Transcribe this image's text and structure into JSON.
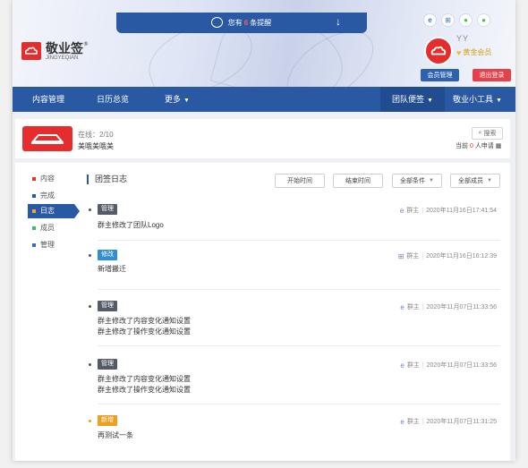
{
  "header": {
    "notice": {
      "prefix": "您有",
      "count": "6",
      "suffix": "条提醒"
    },
    "brand": {
      "name": "敬业签",
      "registered": "®",
      "sub": "JINGYEQIAN"
    },
    "apps": [
      {
        "icon": "ie-icon",
        "glyph": "e",
        "color": "#2f7ad8"
      },
      {
        "icon": "windows-icon",
        "glyph": "⊞",
        "color": "#2f7ad8"
      },
      {
        "icon": "apple-icon",
        "glyph": "●",
        "color": "#57b94a"
      },
      {
        "icon": "android-icon",
        "glyph": "●",
        "color": "#57b94a"
      }
    ],
    "user": {
      "name": "YY",
      "level": "黄金会员"
    },
    "member_button": "会员管理",
    "logout_button": "退出登录"
  },
  "nav": {
    "items": [
      "内容管理",
      "日历总览",
      "更多"
    ],
    "team_note": "团队便签",
    "tools": "敬业小工具"
  },
  "team": {
    "online": "在线：2/10",
    "name": "美哦美哦美",
    "search": "搜索",
    "apply_prefix": "当前",
    "apply_count": "0",
    "apply_suffix": "人申请"
  },
  "sidebar": {
    "items": [
      {
        "label": "内容",
        "color": "#e5322d"
      },
      {
        "label": "完成",
        "color": "#2a59a4"
      },
      {
        "label": "日志",
        "color": "#f3a531"
      },
      {
        "label": "成员",
        "color": "#3bbf6b"
      },
      {
        "label": "管理",
        "color": "#3a6bc4"
      }
    ]
  },
  "log": {
    "title": "团签日志",
    "filters": {
      "start": "开始时间",
      "end": "结束时间",
      "condition": "全部条件",
      "members": "全部成员"
    },
    "entries": [
      {
        "tag": "管理",
        "tag_color": "#555b66",
        "lines": [
          "群主修改了团队Logo"
        ],
        "author": "群主",
        "time": "2020年11月16日17:41:54"
      },
      {
        "tag": "修改",
        "tag_color": "#2e8fd6",
        "lines": [
          "新增搬迁"
        ],
        "author": "群主",
        "time": "2020年11月16日16:12:39"
      },
      {
        "tag": "管理",
        "tag_color": "#555b66",
        "lines": [
          "群主修改了内容变化通知设置",
          "群主修改了操作变化通知设置"
        ],
        "author": "群主",
        "time": "2020年11月07日11:33:56"
      },
      {
        "tag": "管理",
        "tag_color": "#555b66",
        "lines": [
          "群主修改了内容变化通知设置",
          "群主修改了操作变化通知设置"
        ],
        "author": "群主",
        "time": "2020年11月07日11:33:56"
      },
      {
        "tag": "新增",
        "tag_color": "#f0a020",
        "lines": [
          "再测试一条"
        ],
        "author": "群主",
        "time": "2020年11月07日11:31:25"
      }
    ]
  }
}
